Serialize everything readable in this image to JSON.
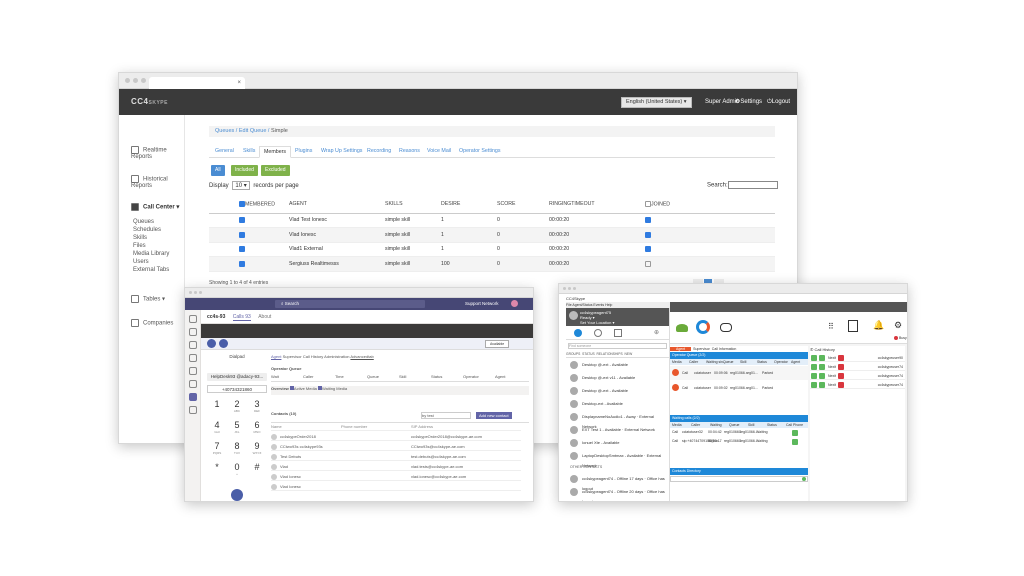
{
  "browser": {
    "tab_close": "×"
  },
  "main": {
    "logo": "CC4",
    "logo_sub": "SKYPE",
    "topbar": {
      "language": "English (United States) ▾",
      "role": "Super Admin",
      "settings": "⚙Settings",
      "logout": "⏻Logout"
    },
    "sidebar": [
      {
        "label": "Realtime Reports",
        "icon": "clock-icon"
      },
      {
        "label": "Historical Reports",
        "icon": "calendar-icon"
      },
      {
        "label": "Call Center ▾",
        "icon": "phone-icon"
      },
      {
        "label": "Queues"
      },
      {
        "label": "Schedules"
      },
      {
        "label": "Skills"
      },
      {
        "label": "Files"
      },
      {
        "label": "Media Library"
      },
      {
        "label": "Users"
      },
      {
        "label": "External Tabs"
      },
      {
        "label": "Tables ▾",
        "icon": "table-icon"
      },
      {
        "label": "Companies",
        "icon": "building-icon"
      }
    ],
    "breadcrumb": [
      "Queues",
      "Edit Queue",
      "Simple"
    ],
    "tabs": [
      "General",
      "Skills",
      "Members",
      "Plugins",
      "Wrap Up Settings",
      "Recording",
      "Reasons",
      "Voice Mail",
      "Operator Settings"
    ],
    "active_tab": "Members",
    "filters": {
      "all": "All",
      "included": "Included",
      "excluded": "Excluded"
    },
    "show": {
      "prefix": "Display",
      "value": "10",
      "suffix": "records per page"
    },
    "search_label": "Search:",
    "columns": [
      "MEMBERED",
      "AGENT",
      "SKILLS",
      "DESIRE",
      "SCORE",
      "RINGINGTIMEOUT",
      "JOINED"
    ],
    "rows": [
      {
        "membered": true,
        "agent": "Vlad Test Ionesc",
        "skills": "simple skill",
        "desire": "1",
        "score": "0",
        "timeout": "00:00:20",
        "joined": true
      },
      {
        "membered": true,
        "agent": "Vlad Ionesc",
        "skills": "simple skill",
        "desire": "1",
        "score": "0",
        "timeout": "00:00:20",
        "joined": true
      },
      {
        "membered": true,
        "agent": "Vlad1 External",
        "skills": "simple skill",
        "desire": "1",
        "score": "0",
        "timeout": "00:00:20",
        "joined": true
      },
      {
        "membered": true,
        "agent": "Sergiuss Realtimesss",
        "skills": "simple skill",
        "desire": "100",
        "score": "0",
        "timeout": "00:00:20",
        "joined": false
      }
    ],
    "footer": "Showing 1 to 4 of 4 entries"
  },
  "teams": {
    "search": "Search",
    "user": "Support Network",
    "app_title": "cc4s-93",
    "app_tabs": [
      "Calls 93",
      "About"
    ],
    "status": "Available",
    "dialer_label": "Dialpad",
    "number": "HelpDesk93 @adacy-93...",
    "display": "+40734321860",
    "keys": [
      [
        "1",
        ""
      ],
      [
        "2",
        "ABC"
      ],
      [
        "3",
        "DEF"
      ],
      [
        "4",
        "GHI"
      ],
      [
        "5",
        "JKL"
      ],
      [
        "6",
        "MNO"
      ],
      [
        "7",
        "PQRS"
      ],
      [
        "8",
        "TUV"
      ],
      [
        "9",
        "WXYZ"
      ],
      [
        "*",
        ""
      ],
      [
        "0",
        "+"
      ],
      [
        "#",
        ""
      ]
    ],
    "cc_tabs": [
      "Agent",
      "Supervisor",
      "Call History",
      "Administration",
      "Advancedtab"
    ],
    "operator_queue": "Operator Queue",
    "queue_cols": [
      "Wait",
      "Caller",
      "Time",
      "Queue",
      "Skill",
      "Status",
      "Operator",
      "Agent"
    ],
    "overview": "Overview",
    "overview_opts": [
      "Active Media",
      "Waiting Media"
    ],
    "contacts": "Contacts (10)",
    "add_contact": "Add new contact",
    "search_value": "by test",
    "contact_cols": [
      "Name",
      "Phone number",
      "SIP Address"
    ],
    "contact_list": [
      {
        "name": "cc4skypeOrder2018",
        "sip": "cc4skypeOrder2018@cc4skype-ae.com"
      },
      {
        "name": "CCtwo93s cc4skype93s",
        "sip": "CCtwo93s@cc4skype-ae.com"
      },
      {
        "name": "Test Debuts",
        "sip": "test.debuts@cc4skype-ae.com"
      },
      {
        "name": "Vlad",
        "sip": "vlad.tests@cc4skype-ae.com"
      },
      {
        "name": "Vlad Ionesc",
        "sip": "vlad.ionesc@cc4skype-ae.com"
      },
      {
        "name": "Vlad Ionesc",
        "sip": ""
      }
    ]
  },
  "skype": {
    "title": "CC4Skype",
    "menu": "File  Agent/Status  Events  Help",
    "user": "cc4skypeagent75",
    "user_status": "Ready ▾",
    "user_sub": "Set Your Location ▾",
    "search_placeholder": "Find someone",
    "filters": [
      "GROUPS",
      "STATUS",
      "RELATIONSHIPS",
      "NEW"
    ],
    "contacts": [
      "Desktop @-ext - Available",
      "Desktop @-ext v11 - Available",
      "Desktop @-ext - Available",
      "Desktop-ext - Available",
      "DisplaynameNoAudio1 - Away · External Network",
      "EXT Test 1 - Available · External Network",
      "Ionuel Xte - Available",
      "LaptopDesktopSmtmax - Available · External Network",
      "cc4skypeagent74 - Offline 17 days · Office has logout",
      "cc4skypeagent74 - Offline 20 days · Office has logout"
    ],
    "other": "OTHER CONTACTS",
    "tabs": [
      "Agent",
      "Supervisor",
      "Call Information"
    ],
    "op_queue": "Operator Queue (2/2)",
    "op_cols": [
      "Media",
      "Caller",
      "Waiting sin...",
      "Queue",
      "Skill",
      "Status",
      "Operator",
      "Agent"
    ],
    "op_rows": [
      {
        "media": "Call",
        "caller": "cclatotuser",
        "wait": "00:09:06",
        "queue": "reg01066...",
        "skill": "reg01...",
        "status": "Parked"
      },
      {
        "media": "Call",
        "caller": "cclatotuser",
        "wait": "00:09:02",
        "queue": "reg01066...",
        "skill": "reg01...",
        "status": "Parked"
      }
    ],
    "waiting": "Waiting calls (2/2)",
    "wait_cols": [
      "Media",
      "Caller",
      "Waiting",
      "Queue",
      "Skill",
      "Status",
      "Call Phone"
    ],
    "wait_rows": [
      {
        "media": "Call",
        "caller": "cclatotuser32",
        "wait": "00:04:42",
        "queue": "reg01066C",
        "skill": "reg01066...",
        "status": "Waiting"
      },
      {
        "media": "Call",
        "caller": "sip:+40744709106@cc...",
        "wait": "00:00:17",
        "queue": "reg01066C",
        "skill": "reg01066...",
        "status": "Waiting"
      }
    ],
    "contacts_dir": "Contacts Directory",
    "history": "Call History",
    "history_rows": [
      {
        "dir": "Nexit",
        "name": "cc4skypeuser90"
      },
      {
        "dir": "Nexit",
        "name": "cc4skypeuser74"
      },
      {
        "dir": "Nexit",
        "name": "cc4skypeuser74"
      },
      {
        "dir": "Nexit",
        "name": "cc4skypeuser74"
      }
    ],
    "busy": "Busy"
  }
}
